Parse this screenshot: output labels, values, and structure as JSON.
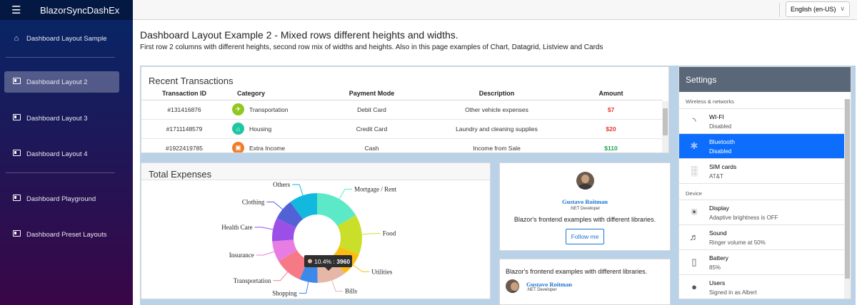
{
  "app": {
    "brand": "BlazorSyncDashEx",
    "language": "English (en-US)"
  },
  "sidebar": {
    "items": [
      {
        "label": "Dashboard Layout Sample",
        "icon": "home-icon"
      },
      {
        "label": "Dashboard Layout 2",
        "icon": "dashboard-icon",
        "active": true
      },
      {
        "label": "Dashboard Layout 3",
        "icon": "dashboard-icon"
      },
      {
        "label": "Dashboard Layout 4",
        "icon": "dashboard-icon"
      },
      {
        "label": "Dashboard Playground",
        "icon": "dashboard-icon"
      },
      {
        "label": "Dashboard Preset Layouts",
        "icon": "dashboard-icon"
      }
    ]
  },
  "page": {
    "title": "Dashboard Layout Example 2 - Mixed rows different heights and widths.",
    "subtitle": "First row 2 columns with different heights, second row mix of widths and heights. Also in this page examples of Chart, Datagrid, Listview and Cards"
  },
  "transactions": {
    "title": "Recent Transactions",
    "columns": [
      "Transaction ID",
      "Category",
      "Payment Mode",
      "Description",
      "Amount"
    ],
    "rows": [
      {
        "id": "#131416876",
        "category": "Transportation",
        "icon": "plane-icon",
        "color": "#8fc81f",
        "payment": "Debit Card",
        "description": "Other vehicle expenses",
        "amount": "$7",
        "amount_color": "#e53935"
      },
      {
        "id": "#1711148579",
        "category": "Housing",
        "icon": "house-icon",
        "color": "#1dc7a1",
        "payment": "Credit Card",
        "description": "Laundry and cleaning supplies",
        "amount": "$20",
        "amount_color": "#e53935"
      },
      {
        "id": "#1922419785",
        "category": "Extra Income",
        "icon": "income-icon",
        "color": "#f07c2a",
        "payment": "Cash",
        "description": "Income from Sale",
        "amount": "$110",
        "amount_color": "#1ca451"
      }
    ]
  },
  "expenses": {
    "title": "Total Expenses",
    "tooltip": {
      "percent": "10.4%",
      "value": "3960"
    }
  },
  "chart_data": {
    "type": "pie",
    "title": "Total Expenses",
    "categories": [
      "Mortgage / Rent",
      "Food",
      "Utilities",
      "Bills",
      "Shopping",
      "Transportation",
      "Insurance",
      "Health Care",
      "Clothing",
      "Others"
    ],
    "values": [
      16.5,
      14.5,
      8.5,
      10.4,
      6.5,
      10,
      7.5,
      8.5,
      7.5,
      10.2
    ],
    "colors": [
      "#5ce9c8",
      "#cadf2a",
      "#fcbd11",
      "#e6b7a6",
      "#3c89ea",
      "#f57a85",
      "#e77ce3",
      "#9b4fe7",
      "#5261d6",
      "#12b8de"
    ]
  },
  "profile": {
    "name": "Gustavo Roitman",
    "role": ".NET Developer",
    "description": "Blazor's frontend examples with different libraries.",
    "follow_label": "Follow me"
  },
  "profile2": {
    "description": "Blazor's frontend examples with different libraries.",
    "name": "Gustavo Roitman",
    "role": ".NET Developer"
  },
  "settings": {
    "title": "Settings",
    "group1": "Wireless & networks",
    "group2": "Device",
    "items1": [
      {
        "title": "WI-FI",
        "sub": "Disabled",
        "icon": "wifi-icon"
      },
      {
        "title": "Bluetooth",
        "sub": "Disabled",
        "icon": "bluetooth-icon",
        "selected": true
      },
      {
        "title": "SIM cards",
        "sub": "AT&T",
        "icon": "signal-icon"
      }
    ],
    "items2": [
      {
        "title": "Display",
        "sub": "Adaptive brightness is OFF",
        "icon": "brightness-icon"
      },
      {
        "title": "Sound",
        "sub": "Ringer volume at 50%",
        "icon": "volume-icon"
      },
      {
        "title": "Battery",
        "sub": "85%",
        "icon": "battery-icon"
      },
      {
        "title": "Users",
        "sub": "Signed in as Albert",
        "icon": "user-icon"
      }
    ]
  }
}
